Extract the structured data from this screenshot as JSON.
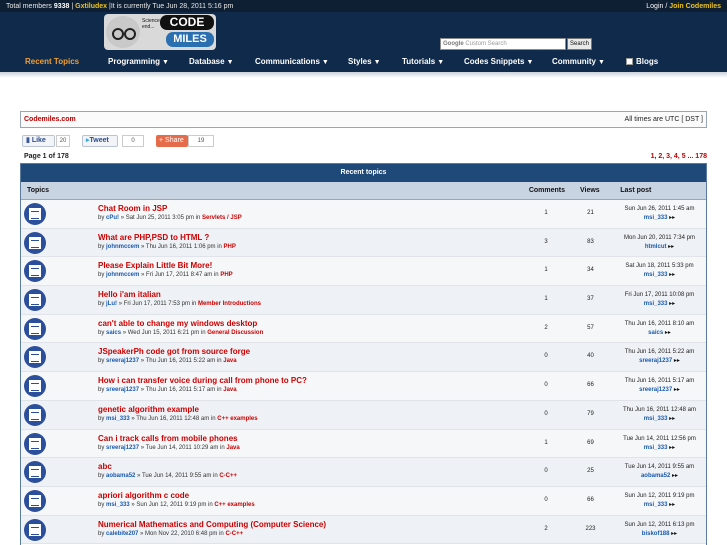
{
  "topbar": {
    "members_label": "Total members",
    "members_count": "9338",
    "sep": "|",
    "newest": "Gxtiludex",
    "time_text": "|It is currently Tue Jun 28, 2011 5:16 pm",
    "login": "Login",
    "join": "Join Codemiles",
    "slash": "/"
  },
  "logo": {
    "code": "CODE",
    "miles": "MILES",
    "quote": "Science will never make an end..."
  },
  "search": {
    "google": "Google",
    "placeholder": "Custom Search",
    "button": "Search"
  },
  "nav": [
    {
      "label": "Recent Topics",
      "caret": ""
    },
    {
      "label": "Programming",
      "caret": "▼"
    },
    {
      "label": "Database",
      "caret": "▼"
    },
    {
      "label": "Communications",
      "caret": "▼"
    },
    {
      "label": "Styles",
      "caret": "▼"
    },
    {
      "label": "Tutorials",
      "caret": "▼"
    },
    {
      "label": "Codes Snippets",
      "caret": "▼"
    },
    {
      "label": "Community",
      "caret": "▼"
    },
    {
      "label": "Blogs",
      "caret": ""
    }
  ],
  "sitebar": {
    "name": "Codemiles.com",
    "tz": "All times are UTC [ DST ]"
  },
  "social": {
    "like": "Like",
    "like_count": "20",
    "tweet": "Tweet",
    "tweet_count": "0",
    "share": "Share",
    "share_count": "19"
  },
  "page": {
    "info": "Page 1 of 178",
    "pagination": "1, 2, 3, 4, 5 ... 178"
  },
  "table": {
    "title": "Recent topics",
    "headers": {
      "topics": "Topics",
      "comments": "Comments",
      "views": "Views",
      "last": "Last post"
    },
    "rows": [
      {
        "title": "Chat Room in JSP",
        "by": "by",
        "user": "cPu!",
        "date": "» Sat Jun 25, 2011 3:05 pm in",
        "forum": "Servlets / JSP",
        "comments": "1",
        "views": "21",
        "last_date": "Sun Jun 26, 2011 1:45 am",
        "last_user": "msi_333"
      },
      {
        "title": "What are PHP,PSD to HTML ?",
        "by": "by",
        "user": "johnmccem",
        "date": "» Thu Jun 16, 2011 1:06 pm in",
        "forum": "PHP",
        "comments": "3",
        "views": "83",
        "last_date": "Mon Jun 20, 2011 7:34 pm",
        "last_user": "htmlcut"
      },
      {
        "title": "Please Explain Little Bit More!",
        "by": "by",
        "user": "johnmccem",
        "date": "» Fri Jun 17, 2011 8:47 am in",
        "forum": "PHP",
        "comments": "1",
        "views": "34",
        "last_date": "Sat Jun 18, 2011 5:33 pm",
        "last_user": "msi_333"
      },
      {
        "title": "Hello i'am italian",
        "by": "by",
        "user": "jLu!",
        "date": "» Fri Jun 17, 2011 7:53 pm in",
        "forum": "Member Introductions",
        "comments": "1",
        "views": "37",
        "last_date": "Fri Jun 17, 2011 10:08 pm",
        "last_user": "msi_333"
      },
      {
        "title": "can't able to change my windows desktop",
        "by": "by",
        "user": "saics",
        "date": "» Wed Jun 15, 2011 6:21 pm in",
        "forum": "General Discussion",
        "comments": "2",
        "views": "57",
        "last_date": "Thu Jun 16, 2011 8:10 am",
        "last_user": "saics"
      },
      {
        "title": "JSpeakerPh code got from source forge",
        "by": "by",
        "user": "sreeraj1237",
        "date": "» Thu Jun 16, 2011 5:22 am in",
        "forum": "Java",
        "comments": "0",
        "views": "40",
        "last_date": "Thu Jun 16, 2011 5:22 am",
        "last_user": "sreeraj1237"
      },
      {
        "title": "How i can transfer voice during call from phone to PC?",
        "by": "by",
        "user": "sreeraj1237",
        "date": "» Thu Jun 16, 2011 5:17 am in",
        "forum": "Java",
        "comments": "0",
        "views": "66",
        "last_date": "Thu Jun 16, 2011 5:17 am",
        "last_user": "sreeraj1237"
      },
      {
        "title": "genetic algorithm example",
        "by": "by",
        "user": "msi_333",
        "date": "» Thu Jun 16, 2011 12:48 am in",
        "forum": "C++ examples",
        "comments": "0",
        "views": "79",
        "last_date": "Thu Jun 16, 2011 12:48 am",
        "last_user": "msi_333"
      },
      {
        "title": "Can i track calls from mobile phones",
        "by": "by",
        "user": "sreeraj1237",
        "date": "» Tue Jun 14, 2011 10:29 am in",
        "forum": "Java",
        "comments": "1",
        "views": "69",
        "last_date": "Tue Jun 14, 2011 12:56 pm",
        "last_user": "msi_333"
      },
      {
        "title": "abc",
        "by": "by",
        "user": "aobama52",
        "date": "» Tue Jun 14, 2011 9:55 am in",
        "forum": "C-C++",
        "comments": "0",
        "views": "25",
        "last_date": "Tue Jun 14, 2011 9:55 am",
        "last_user": "aobama52"
      },
      {
        "title": "apriori algorithm c code",
        "by": "by",
        "user": "msi_333",
        "date": "» Sun Jun 12, 2011 9:19 pm in",
        "forum": "C++ examples",
        "comments": "0",
        "views": "66",
        "last_date": "Sun Jun 12, 2011 9:19 pm",
        "last_user": "msi_333"
      },
      {
        "title": "Numerical Mathematics and Computing (Computer Science)",
        "by": "by",
        "user": "calebite207",
        "date": "» Mon Nov 22, 2010 6:48 pm in",
        "forum": "C-C++",
        "comments": "2",
        "views": "223",
        "last_date": "Sun Jun 12, 2011 6:13 pm",
        "last_user": "biskof188"
      }
    ]
  },
  "colors": {
    "header": "#0f2a4a",
    "accent_orange": "#f0a030",
    "link_red": "#cc0000",
    "user_blue": "#1a5ab0"
  },
  "icons": {
    "topic": "topic-document-icon",
    "last_post": "view-latest-post-icon",
    "blog": "blog-icon"
  }
}
